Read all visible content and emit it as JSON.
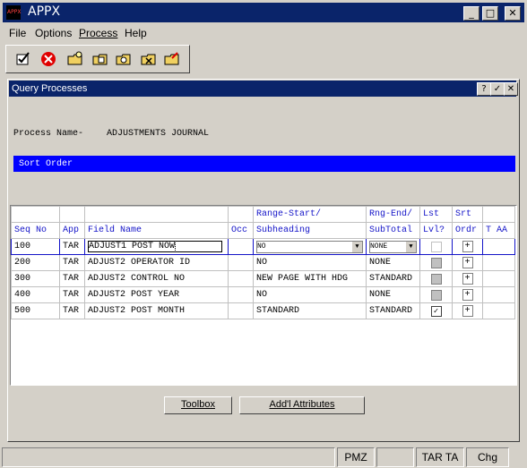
{
  "app": {
    "title": "APPX",
    "logo_text": "APPX"
  },
  "window_controls": {
    "minimize": "_",
    "maximize": "□",
    "close": "✕"
  },
  "menu": [
    "File",
    "Options",
    "Process",
    "Help"
  ],
  "toolbar": [
    {
      "icon": "check-clipboard-icon"
    },
    {
      "icon": "cancel-icon",
      "color": "#e00000"
    },
    {
      "icon": "new-folder-icon"
    },
    {
      "icon": "edit-folder-icon"
    },
    {
      "icon": "find-folder-icon"
    },
    {
      "icon": "delete-folder-icon"
    },
    {
      "icon": "cut-folder-icon"
    }
  ],
  "query": {
    "title": "Query Processes",
    "controls": {
      "help": "?",
      "ok": "✓",
      "close": "✕"
    },
    "process_name_label": "Process Name-",
    "process_name_value": "ADJUSTMENTS JOURNAL",
    "sort_order_label": "Sort Order",
    "header_top": [
      "",
      "",
      "",
      "",
      "Range-Start/",
      "Rng-End/",
      "Lst",
      "Srt",
      ""
    ],
    "header_bottom": [
      "Seq No",
      "App",
      "Field Name",
      "Occ",
      "Subheading",
      "SubTotal",
      "Lvl?",
      "Ordr",
      "T AA"
    ],
    "rows": [
      {
        "seq": "100",
        "app": "TAR",
        "field": "ADJUST1 POST NOW",
        "occ": "",
        "range": "NO",
        "range_dropdown": true,
        "end": "NONE",
        "end_dropdown": true,
        "lvl": "empty",
        "ordr": "+"
      },
      {
        "seq": "200",
        "app": "TAR",
        "field": "ADJUST2 OPERATOR ID",
        "occ": "",
        "range": "NO",
        "range_dropdown": false,
        "end": "NONE",
        "end_dropdown": false,
        "lvl": "gray",
        "ordr": "+"
      },
      {
        "seq": "300",
        "app": "TAR",
        "field": "ADJUST2 CONTROL NO",
        "occ": "",
        "range": "NEW PAGE WITH HDG",
        "range_dropdown": false,
        "end": "STANDARD",
        "end_dropdown": false,
        "lvl": "gray",
        "ordr": "+"
      },
      {
        "seq": "400",
        "app": "TAR",
        "field": "ADJUST2 POST YEAR",
        "occ": "",
        "range": "NO",
        "range_dropdown": false,
        "end": "NONE",
        "end_dropdown": false,
        "lvl": "gray",
        "ordr": "+"
      },
      {
        "seq": "500",
        "app": "TAR",
        "field": "ADJUST2 POST MONTH",
        "occ": "",
        "range": "STANDARD",
        "range_dropdown": false,
        "end": "STANDARD",
        "end_dropdown": false,
        "lvl": "checked",
        "ordr": "+"
      }
    ],
    "buttons": {
      "toolbox": "Toolbox",
      "attributes": "Add'l Attributes"
    }
  },
  "status": [
    "",
    "PMZ",
    "",
    "TAR TA",
    "Chg"
  ]
}
